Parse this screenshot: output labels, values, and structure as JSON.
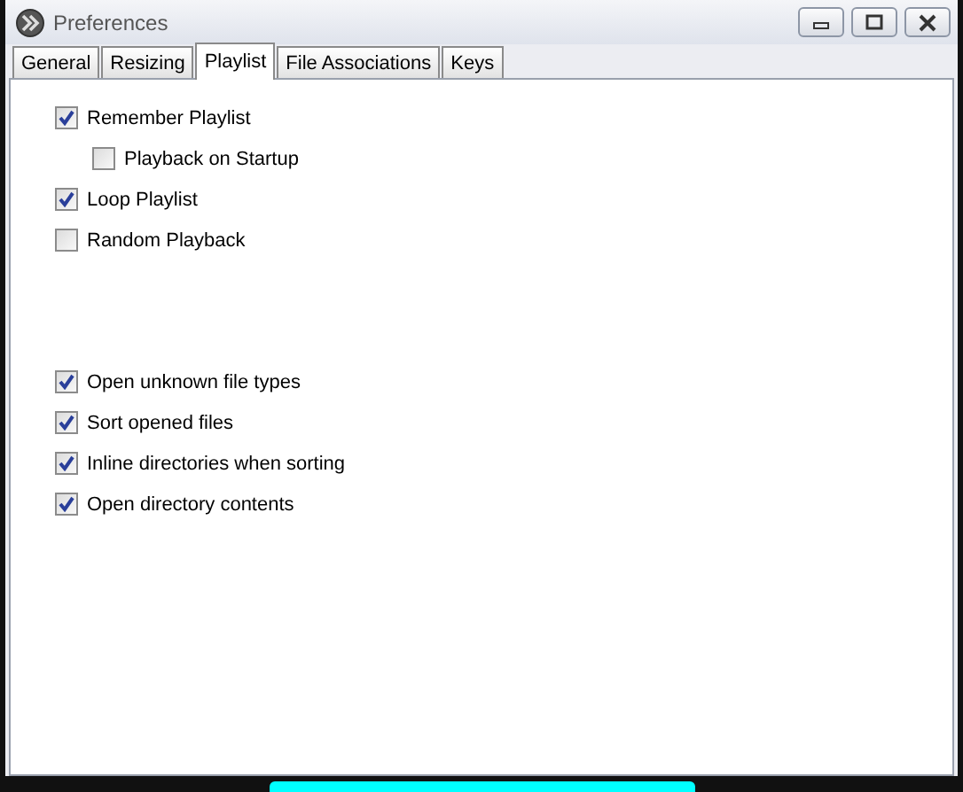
{
  "window": {
    "title": "Preferences"
  },
  "tabs": [
    {
      "label": "General",
      "selected": false
    },
    {
      "label": "Resizing",
      "selected": false
    },
    {
      "label": "Playlist",
      "selected": true
    },
    {
      "label": "File Associations",
      "selected": false
    },
    {
      "label": "Keys",
      "selected": false
    }
  ],
  "groups": [
    {
      "items": [
        {
          "label": "Remember Playlist",
          "checked": true,
          "children": [
            {
              "label": "Playback on Startup",
              "checked": false
            }
          ]
        },
        {
          "label": "Loop Playlist",
          "checked": true
        },
        {
          "label": "Random Playback",
          "checked": false
        }
      ]
    },
    {
      "items": [
        {
          "label": "Open unknown file types",
          "checked": true
        },
        {
          "label": "Sort opened files",
          "checked": true
        },
        {
          "label": "Inline directories when sorting",
          "checked": true
        },
        {
          "label": "Open directory contents",
          "checked": true
        }
      ]
    }
  ]
}
